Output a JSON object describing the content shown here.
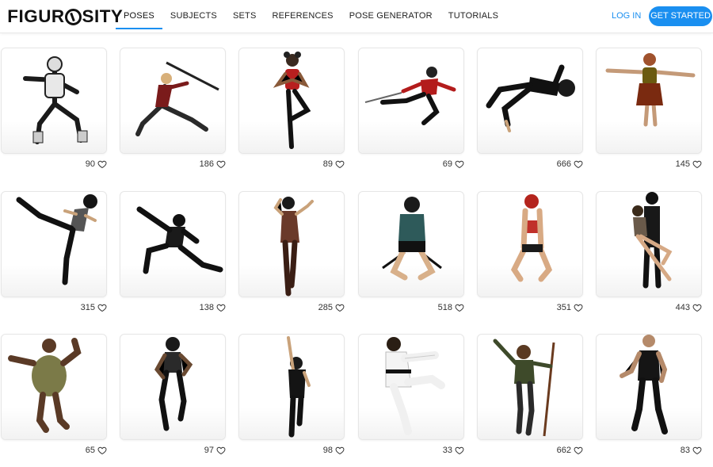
{
  "header": {
    "logo": "FIGUROSITY",
    "nav": [
      {
        "label": "POSES",
        "active": true
      },
      {
        "label": "SUBJECTS",
        "active": false
      },
      {
        "label": "SETS",
        "active": false
      },
      {
        "label": "REFERENCES",
        "active": false
      },
      {
        "label": "POSE GENERATOR",
        "active": false
      },
      {
        "label": "TUTORIALS",
        "active": false
      }
    ],
    "login": "LOG IN",
    "cta": "GET STARTED",
    "accent": "#1a8ff0"
  },
  "poses": [
    {
      "likes": "90",
      "figure": "robot-suit-stance"
    },
    {
      "likes": "186",
      "figure": "staff-lunge"
    },
    {
      "likes": "89",
      "figure": "prayer-balance"
    },
    {
      "likes": "69",
      "figure": "flying-kick-sword"
    },
    {
      "likes": "666",
      "figure": "lying-back"
    },
    {
      "likes": "145",
      "figure": "t-pose-float"
    },
    {
      "likes": "315",
      "figure": "high-kick"
    },
    {
      "likes": "138",
      "figure": "low-lunge"
    },
    {
      "likes": "285",
      "figure": "boots-dance"
    },
    {
      "likes": "518",
      "figure": "kneeling-swords"
    },
    {
      "likes": "351",
      "figure": "kneeling-pose"
    },
    {
      "likes": "443",
      "figure": "couple-embrace"
    },
    {
      "likes": "65",
      "figure": "heavy-stance"
    },
    {
      "likes": "97",
      "figure": "running"
    },
    {
      "likes": "98",
      "figure": "arm-raised"
    },
    {
      "likes": "33",
      "figure": "karate-kick"
    },
    {
      "likes": "662",
      "figure": "staff-holder"
    },
    {
      "likes": "83",
      "figure": "standing-man"
    }
  ]
}
